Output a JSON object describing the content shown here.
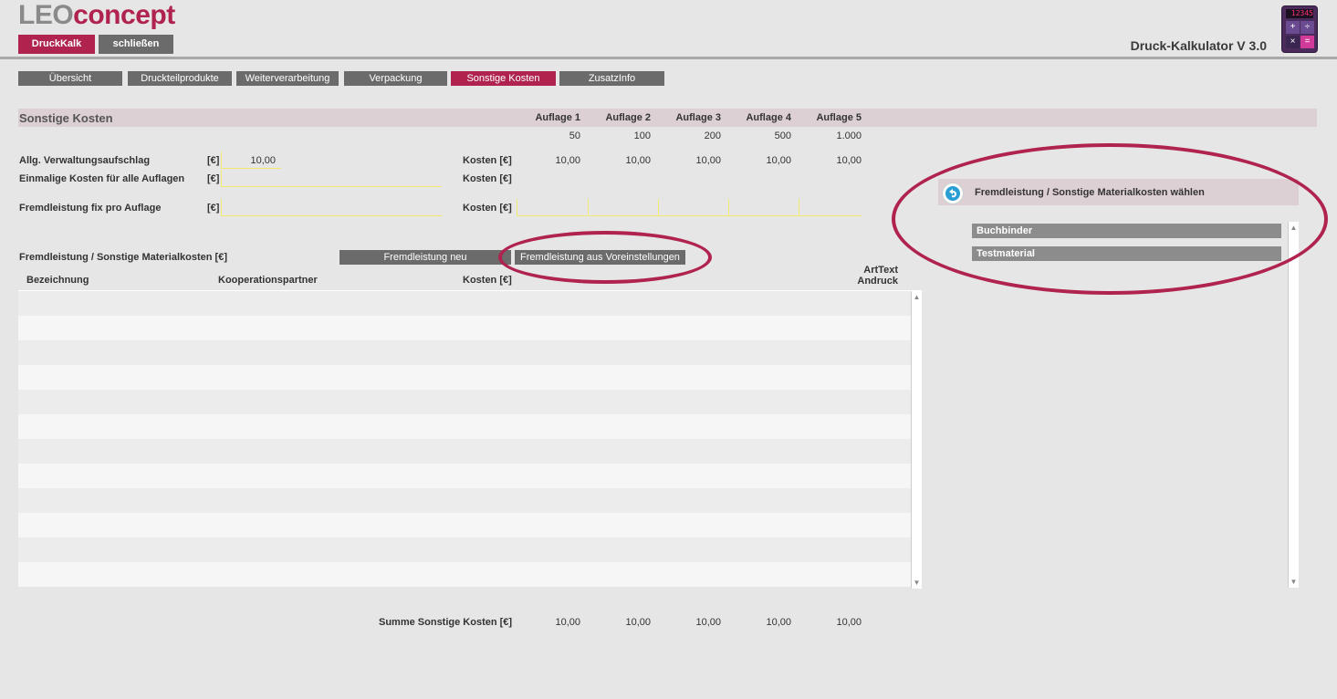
{
  "logo": {
    "part1": "LEO",
    "part2": "concept"
  },
  "topbar": {
    "druckkalk": "DruckKalk",
    "close": "schließen",
    "title": "Druck-Kalkulator V 3.0"
  },
  "calculator_icon": {
    "display": "12345",
    "keys": [
      "+",
      "÷",
      "×",
      "="
    ]
  },
  "tabs": [
    "Übersicht",
    "Druckteilprodukte",
    "Weiterverarbeitung",
    "Verpackung",
    "Sonstige Kosten",
    "ZusatzInfo"
  ],
  "section": {
    "title": "Sonstige Kosten",
    "auflagen": [
      "Auflage 1",
      "Auflage 2",
      "Auflage 3",
      "Auflage 4",
      "Auflage 5"
    ],
    "quantities": [
      "50",
      "100",
      "200",
      "500",
      "1.000"
    ]
  },
  "rows": {
    "verwaltung": {
      "label": "Allg. Verwaltungsaufschlag",
      "unit": "[€]",
      "value": "10,00",
      "kosten": "Kosten [€]",
      "values": [
        "10,00",
        "10,00",
        "10,00",
        "10,00",
        "10,00"
      ]
    },
    "einmalig": {
      "label": "Einmalige Kosten für alle Auflagen",
      "unit": "[€]",
      "kosten": "Kosten [€]"
    },
    "fremd_fix": {
      "label": "Fremdleistung fix pro Auflage",
      "unit": "[€]",
      "kosten": "Kosten [€]"
    }
  },
  "fremdleistung": {
    "label": "Fremdleistung /  Sonstige Materialkosten [€]",
    "btn_new": "Fremdleistung neu",
    "btn_presets": "Fremdleistung aus Voreinstellungen",
    "columns": {
      "bezeichnung": "Bezeichnung",
      "partner": "Kooperationspartner",
      "kosten": "Kosten [€]",
      "arttext1": "ArtText",
      "arttext2": "Andruck"
    }
  },
  "summe": {
    "label": "Summe Sonstige Kosten [€]",
    "values": [
      "10,00",
      "10,00",
      "10,00",
      "10,00",
      "10,00"
    ]
  },
  "right_panel": {
    "title": "Fremdleistung /  Sonstige Materialkosten wählen",
    "items": [
      "Buchbinder",
      "Testmaterial"
    ]
  },
  "colors": {
    "accent": "#b0234f",
    "tab": "#6b6b6b",
    "highlight": "#ddd0d4"
  }
}
